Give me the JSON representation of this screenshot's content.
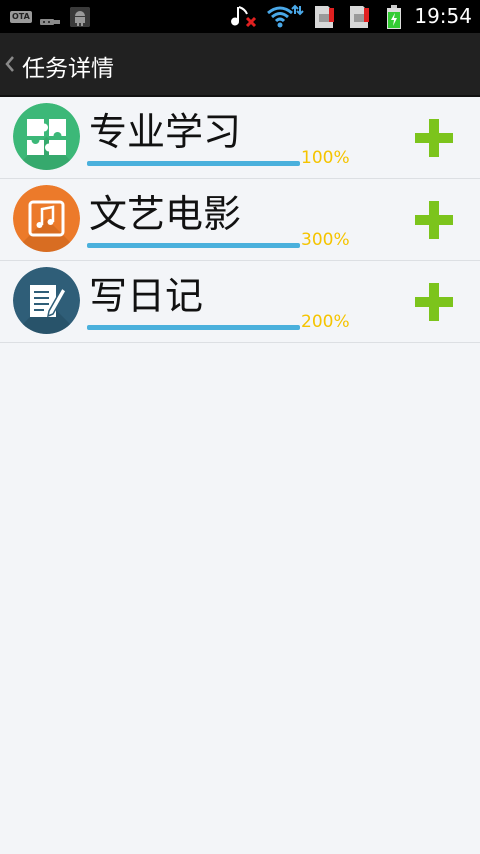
{
  "status_bar": {
    "ota_label": "OTA",
    "time": "19:54",
    "icons": [
      "usb-icon",
      "android-debug-icon",
      "music-muted-icon",
      "wifi-icon",
      "sim-card-icon",
      "sim-card-icon",
      "battery-charging-icon"
    ]
  },
  "title_bar": {
    "back_icon": "chevron-left-icon",
    "title": "任务详情"
  },
  "tasks": [
    {
      "name": "专业学习",
      "progress_text": "100%",
      "progress": 1.0,
      "icon": "puzzle-icon",
      "icon_color": "#3cb878",
      "add_icon": "plus-icon"
    },
    {
      "name": "文艺电影",
      "progress_text": "300%",
      "progress": 1.0,
      "icon": "music-note-icon",
      "icon_color": "#ec7a2a",
      "add_icon": "plus-icon"
    },
    {
      "name": "写日记",
      "progress_text": "200%",
      "progress": 1.0,
      "icon": "document-pen-icon",
      "icon_color": "#2f5e78",
      "add_icon": "plus-icon"
    }
  ],
  "colors": {
    "title_bar": "#212121",
    "background": "#f3f5f8",
    "progress": "#4ab0dc",
    "progress_text": "#f5c400",
    "plus": "#7cc41c"
  }
}
